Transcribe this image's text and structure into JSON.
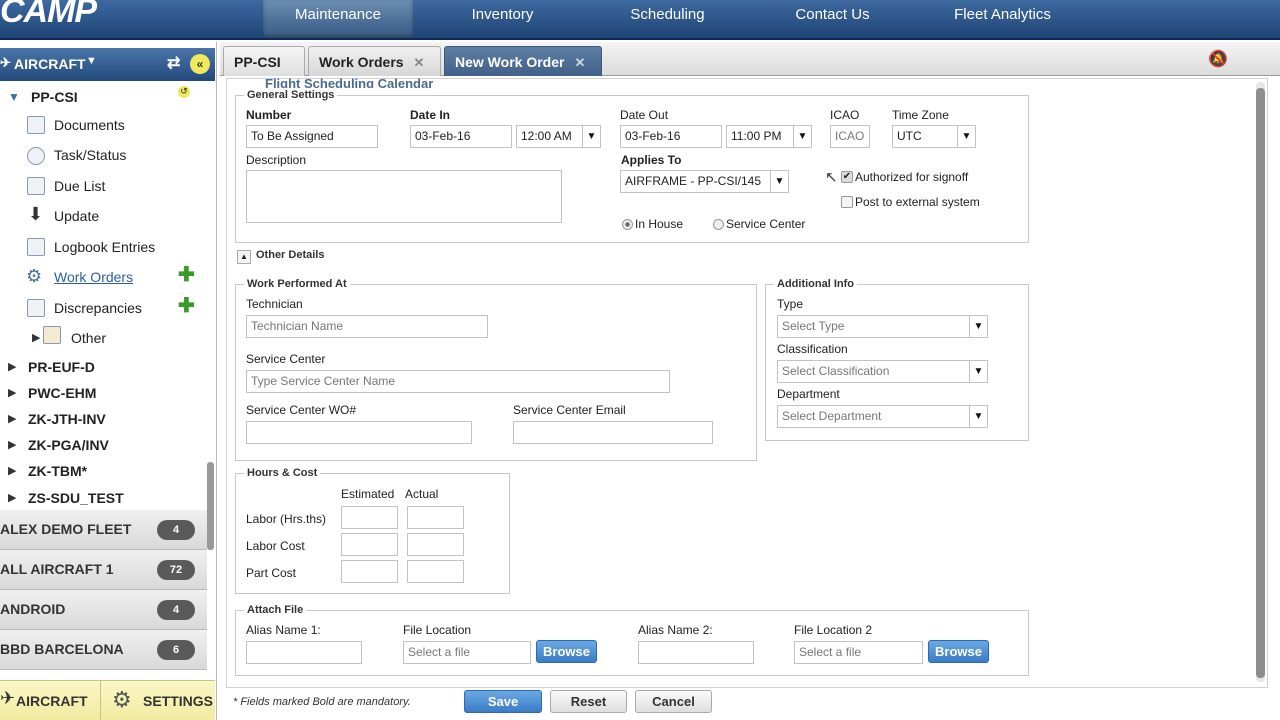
{
  "app": {
    "logo": "CAMP"
  },
  "nav": {
    "items": [
      "Maintenance",
      "Inventory",
      "Scheduling",
      "Contact Us",
      "Fleet Analytics"
    ]
  },
  "sidebar": {
    "header": "AIRCRAFT",
    "current_aircraft": "PP-CSI",
    "sub_items": [
      "Documents",
      "Task/Status",
      "Due List",
      "Update",
      "Logbook Entries",
      "Work Orders",
      "Discrepancies",
      "Other"
    ],
    "aircraft": [
      "PR-EUF-D",
      "PWC-EHM",
      "ZK-JTH-INV",
      "ZK-PGA/INV",
      "ZK-TBM*",
      "ZS-SDU_TEST"
    ],
    "fleets": [
      {
        "name": "ALEX DEMO FLEET",
        "count": "4"
      },
      {
        "name": "ALL AIRCRAFT 1",
        "count": "72"
      },
      {
        "name": "ANDROID",
        "count": "4"
      },
      {
        "name": "BBD BARCELONA",
        "count": "6"
      }
    ],
    "footer": {
      "aircraft": "AIRCRAFT",
      "settings": "SETTINGS"
    }
  },
  "tabs": [
    {
      "label": "PP-CSI"
    },
    {
      "label": "Work Orders",
      "close": "✕"
    },
    {
      "label": "New Work Order",
      "close": "✕"
    }
  ],
  "form": {
    "partial_title": "Flight Scheduling Calendar",
    "general": {
      "legend": "General Settings",
      "number_label": "Number",
      "number_value": "To Be Assigned",
      "date_in_label": "Date In",
      "date_in_value": "03-Feb-16",
      "time_in_value": "12:00 AM",
      "date_out_label": "Date Out",
      "date_out_value": "03-Feb-16",
      "time_out_value": "11:00 PM",
      "icao_label": "ICAO",
      "icao_placeholder": "ICAO",
      "tz_label": "Time Zone",
      "tz_value": "UTC",
      "description_label": "Description",
      "applies_to_label": "Applies To",
      "applies_to_value": "AIRFRAME - PP-CSI/145",
      "authorized_label": "Authorized for signoff",
      "post_external_label": "Post to external system",
      "in_house_label": "In House",
      "service_center_label": "Service Center"
    },
    "other_details": "Other Details",
    "work_performed": {
      "legend": "Work Performed At",
      "technician_label": "Technician",
      "technician_placeholder": "Technician Name",
      "service_center_label": "Service Center",
      "service_center_placeholder": "Type Service Center Name",
      "wo_label": "Service Center WO#",
      "email_label": "Service Center Email"
    },
    "additional": {
      "legend": "Additional Info",
      "type_label": "Type",
      "type_value": "Select Type",
      "class_label": "Classification",
      "class_value": "Select Classification",
      "dept_label": "Department",
      "dept_value": "Select Department"
    },
    "hours": {
      "legend": "Hours & Cost",
      "estimated": "Estimated",
      "actual": "Actual",
      "rows": [
        "Labor (Hrs.ths)",
        "Labor Cost",
        "Part Cost"
      ]
    },
    "attach": {
      "legend": "Attach File",
      "alias1_label": "Alias Name 1:",
      "file_label": "File Location",
      "file_placeholder": "Select a file",
      "browse": "Browse",
      "alias2_label": "Alias Name 2:",
      "file2_label": "File Location 2"
    },
    "footnote": "* Fields marked Bold are mandatory.",
    "buttons": {
      "save": "Save",
      "reset": "Reset",
      "cancel": "Cancel"
    }
  }
}
